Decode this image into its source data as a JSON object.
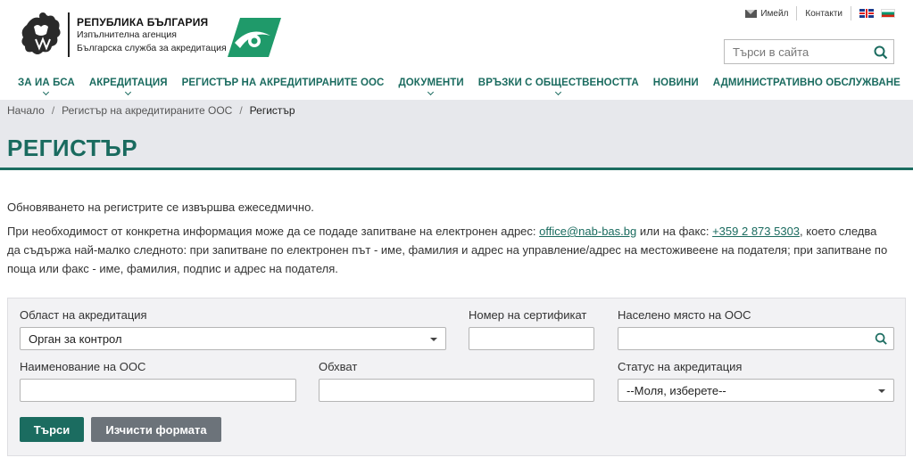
{
  "header": {
    "org_line1": "РЕПУБЛИКА БЪЛГАРИЯ",
    "org_line2": "Изпълнителна агенция",
    "org_line3": "Българска служба за акредитация",
    "email_label": "Имейл",
    "contacts_label": "Контакти",
    "search_placeholder": "Търси в сайта"
  },
  "nav": {
    "items": [
      {
        "label": "ЗА ИА БСА",
        "has_dropdown": true
      },
      {
        "label": "АКРЕДИТАЦИЯ",
        "has_dropdown": true
      },
      {
        "label": "РЕГИСТЪР НА АКРЕДИТИРАНИТЕ ООС",
        "has_dropdown": false
      },
      {
        "label": "ДОКУМЕНТИ",
        "has_dropdown": true
      },
      {
        "label": "ВРЪЗКИ С ОБЩЕСТВЕНОСТТА",
        "has_dropdown": true
      },
      {
        "label": "НОВИНИ",
        "has_dropdown": false
      },
      {
        "label": "АДМИНИСТРАТИВНО ОБСЛУЖВАНЕ",
        "has_dropdown": false
      }
    ]
  },
  "breadcrumb": {
    "items": [
      "Начало",
      "Регистър на акредитираните ООС",
      "Регистър"
    ],
    "separator": "/"
  },
  "page": {
    "title": "РЕГИСТЪР",
    "intro_1": "Обновяването на регистрите се извършва ежеседмично.",
    "intro_2_a": "При необходимост от конкретна информация може да се подаде запитване на електронен адрес: ",
    "email_link": "office@nab-bas.bg",
    "intro_2_b": " или на факс: ",
    "fax_link": "+359 2 873 5303",
    "intro_2_c": ", което следва да съдържа най-малко следното: при запитване по електронен път - име, фамилия и адрес на управление/адрес на местоживеене на подателя; при запитване по поща или факс - име, фамилия, подпис и адрес на подателя."
  },
  "form": {
    "area_label": "Област на акредитация",
    "area_value": "Орган за контрол",
    "cert_label": "Номер на сертификат",
    "cert_value": "",
    "place_label": "Населено място на ООС",
    "place_value": "",
    "name_label": "Наименование на ООС",
    "name_value": "",
    "scope_label": "Обхват",
    "scope_value": "",
    "status_label": "Статус на акредитация",
    "status_value": "--Моля, изберете--",
    "search_button": "Търси",
    "clear_button": "Изчисти формата"
  },
  "colors": {
    "brand": "#1b6c60",
    "band_bg": "#e7e8ec",
    "secondary_button": "#6c737a"
  }
}
